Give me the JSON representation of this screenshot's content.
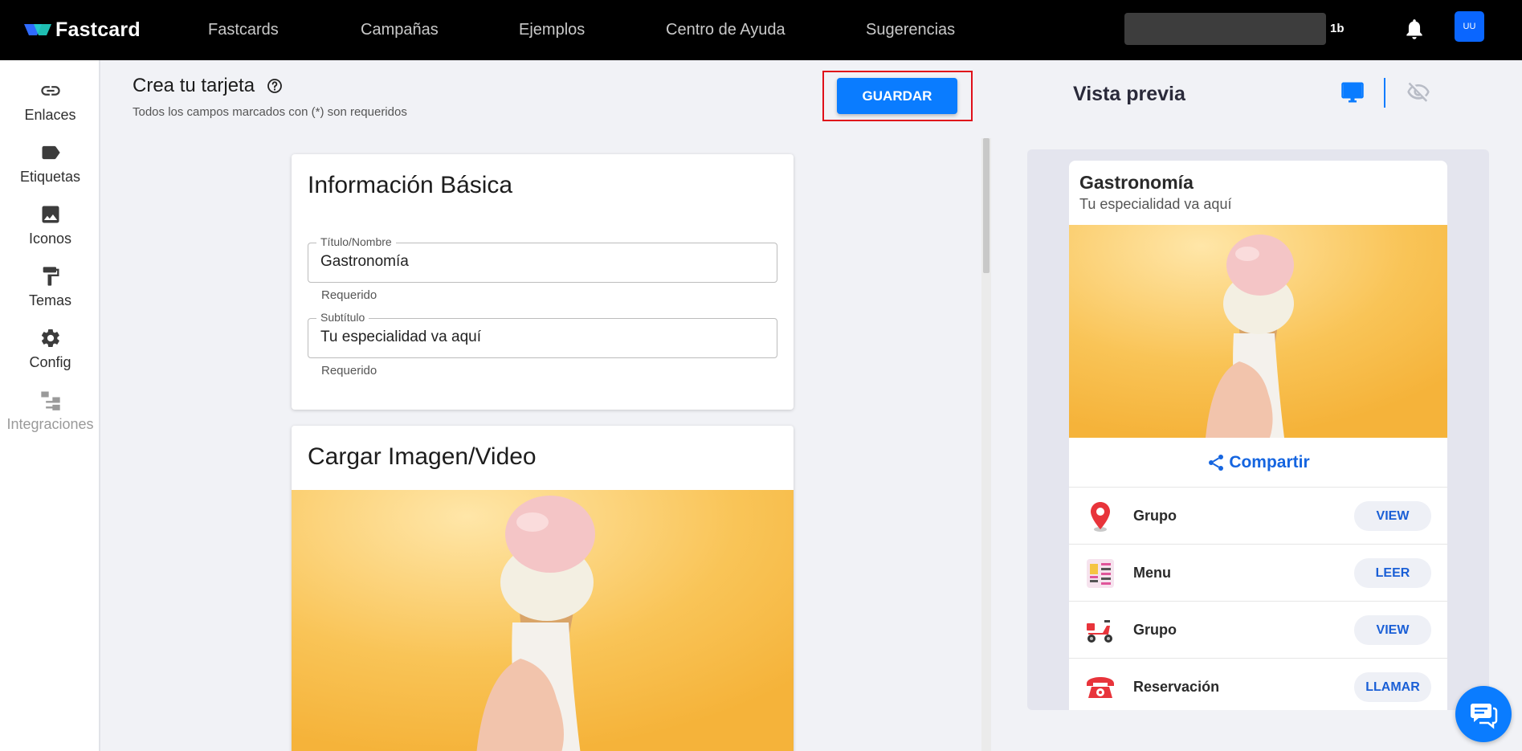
{
  "brand": {
    "name": "Fastcard"
  },
  "nav": {
    "items": [
      {
        "label": "Fastcards"
      },
      {
        "label": "Campañas"
      },
      {
        "label": "Ejemplos"
      },
      {
        "label": "Centro de Ayuda"
      },
      {
        "label": "Sugerencias"
      }
    ],
    "counter": "1b",
    "avatar_initials": "UU"
  },
  "sidebar": {
    "items": [
      {
        "label": "Enlaces",
        "icon": "link-icon"
      },
      {
        "label": "Etiquetas",
        "icon": "tag-icon"
      },
      {
        "label": "Iconos",
        "icon": "image-icon"
      },
      {
        "label": "Temas",
        "icon": "paint-roller-icon"
      },
      {
        "label": "Config",
        "icon": "gear-icon"
      },
      {
        "label": "Integraciones",
        "icon": "integrations-icon",
        "disabled": true
      }
    ]
  },
  "header": {
    "title": "Crea tu tarjeta",
    "subtitle": "Todos los campos marcados con (*) son requeridos",
    "save_label": "GUARDAR"
  },
  "basic_info": {
    "heading": "Información Básica",
    "title_field": {
      "label": "Título/Nombre",
      "value": "Gastronomía",
      "helper": "Requerido"
    },
    "subtitle_field": {
      "label": "Subtítulo",
      "value": "Tu especialidad va aquí",
      "helper": "Requerido"
    }
  },
  "upload": {
    "heading": "Cargar Imagen/Video"
  },
  "preview": {
    "heading": "Vista previa",
    "card_title": "Gastronomía",
    "card_subtitle": "Tu especialidad va aquí",
    "share_label": "Compartir",
    "links": [
      {
        "label": "Grupo",
        "button": "VIEW",
        "icon": "map-pin-icon"
      },
      {
        "label": "Menu",
        "button": "LEER",
        "icon": "menu-icon"
      },
      {
        "label": "Grupo",
        "button": "VIEW",
        "icon": "scooter-icon"
      },
      {
        "label": "Reservación",
        "button": "LLAMAR",
        "icon": "telephone-icon"
      }
    ]
  },
  "colors": {
    "accent": "#0a7cff",
    "topbar": "#000000",
    "highlight_frame": "#e0101a",
    "image_background": "#f7b83f"
  }
}
